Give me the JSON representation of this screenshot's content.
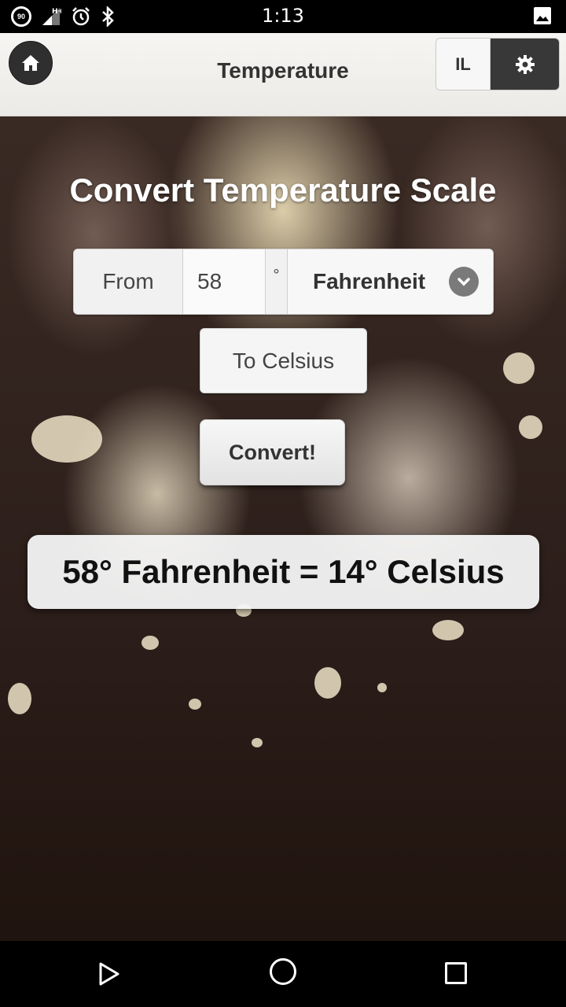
{
  "status_bar": {
    "time": "1:13",
    "battery_level": "90",
    "network": "H+",
    "icons": [
      "battery-circle-icon",
      "signal-icon",
      "alarm-icon",
      "bluetooth-icon",
      "image-notification-icon"
    ]
  },
  "header": {
    "title": "Temperature",
    "home_icon": "home-icon",
    "language_button": "IL",
    "settings_icon": "gear-icon"
  },
  "main": {
    "headline": "Convert Temperature Scale",
    "from_label": "From",
    "input_value": "58",
    "degree_symbol": "°",
    "from_scale": "Fahrenheit",
    "to_button": "To Celsius",
    "convert_button": "Convert!",
    "result": "58° Fahrenheit = 14° Celsius"
  },
  "nav_bar": {
    "icons": [
      "back-icon",
      "home-circle-icon",
      "recents-icon"
    ]
  }
}
